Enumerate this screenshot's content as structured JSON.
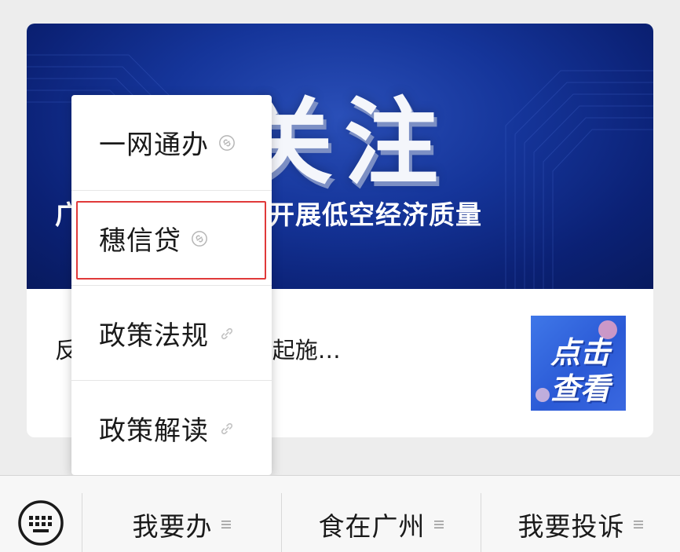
{
  "article": {
    "banner_big_text": "关注",
    "banner_caption": "广州市领导赴南沙开展低空经济质量",
    "card_text": "反…修订，10月15日起施…",
    "thumbnail_lines": [
      "点击",
      "查看"
    ]
  },
  "popup_menu": {
    "items": [
      {
        "label": "一网通办",
        "icon": "link-icon"
      },
      {
        "label": "穗信贷",
        "icon": "link-icon",
        "highlighted": true
      },
      {
        "label": "政策法规",
        "icon": "link-icon"
      },
      {
        "label": "政策解读",
        "icon": "link-icon"
      }
    ]
  },
  "bottom_bar": {
    "keyboard_icon": "keyboard-icon",
    "items": [
      {
        "label": "我要办",
        "icon": "menu-icon"
      },
      {
        "label": "食在广州",
        "icon": "menu-icon"
      },
      {
        "label": "我要投诉",
        "icon": "menu-icon"
      }
    ]
  },
  "colors": {
    "banner_blue": "#15359a",
    "highlight_red": "#e03a3a",
    "background": "#ededed"
  }
}
